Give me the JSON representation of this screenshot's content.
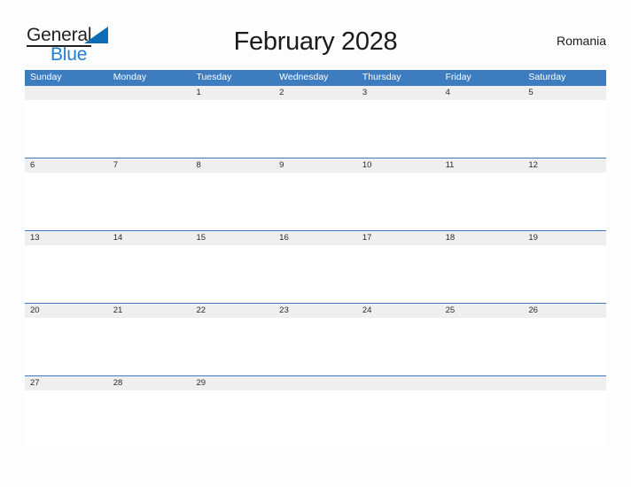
{
  "logo": {
    "text_primary": "General",
    "text_secondary": "Blue",
    "flag_icon": "triangle-flag-icon",
    "accent_color": "#0c6cb5"
  },
  "header": {
    "title": "February 2028",
    "country": "Romania"
  },
  "theme": {
    "header_blue": "#3c7cbf",
    "row_band_gray": "#efefef",
    "page_background": "#fdfdfd",
    "text_color": "#1a1a1a"
  },
  "calendar": {
    "month": "February",
    "year": "2028",
    "weekdays": [
      "Sunday",
      "Monday",
      "Tuesday",
      "Wednesday",
      "Thursday",
      "Friday",
      "Saturday"
    ],
    "weeks": [
      [
        "",
        "",
        "1",
        "2",
        "3",
        "4",
        "5"
      ],
      [
        "6",
        "7",
        "8",
        "9",
        "10",
        "11",
        "12"
      ],
      [
        "13",
        "14",
        "15",
        "16",
        "17",
        "18",
        "19"
      ],
      [
        "20",
        "21",
        "22",
        "23",
        "24",
        "25",
        "26"
      ],
      [
        "27",
        "28",
        "29",
        "",
        "",
        "",
        ""
      ]
    ]
  }
}
